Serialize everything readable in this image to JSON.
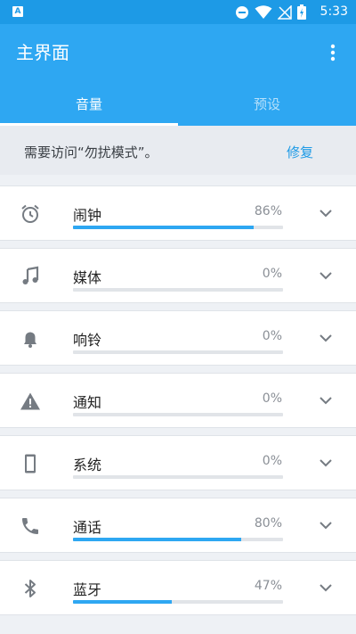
{
  "status_bar": {
    "time": "5:33",
    "icons": [
      "app-badge-icon",
      "do-not-disturb-icon",
      "wifi-icon",
      "no-sim-icon",
      "battery-charging-icon"
    ],
    "app_badge": "A"
  },
  "app_bar": {
    "title": "主界面",
    "menu_icon": "more-vert-icon",
    "tabs": [
      {
        "label": "音量",
        "active": true
      },
      {
        "label": "预设",
        "active": false
      }
    ]
  },
  "notice": {
    "message": "需要访问“勿扰模式”。",
    "action": "修复"
  },
  "volumes": [
    {
      "label": "闹钟",
      "percent_text": "86%",
      "level": 0.86,
      "icon": "alarm-clock-icon"
    },
    {
      "label": "媒体",
      "percent_text": "0%",
      "level": 0.0,
      "icon": "music-note-icon"
    },
    {
      "label": "响铃",
      "percent_text": "0%",
      "level": 0.0,
      "icon": "bell-icon"
    },
    {
      "label": "通知",
      "percent_text": "0%",
      "level": 0.0,
      "icon": "warning-icon"
    },
    {
      "label": "系统",
      "percent_text": "0%",
      "level": 0.0,
      "icon": "phone-device-icon"
    },
    {
      "label": "通话",
      "percent_text": "80%",
      "level": 0.8,
      "icon": "phone-call-icon"
    },
    {
      "label": "蓝牙",
      "percent_text": "47%",
      "level": 0.47,
      "icon": "bluetooth-icon"
    }
  ],
  "colors": {
    "primary": "#2ea7f2",
    "primary_dark": "#1d9ae6",
    "accent_text": "#1d9ae6",
    "icon_gray": "#757b82"
  }
}
